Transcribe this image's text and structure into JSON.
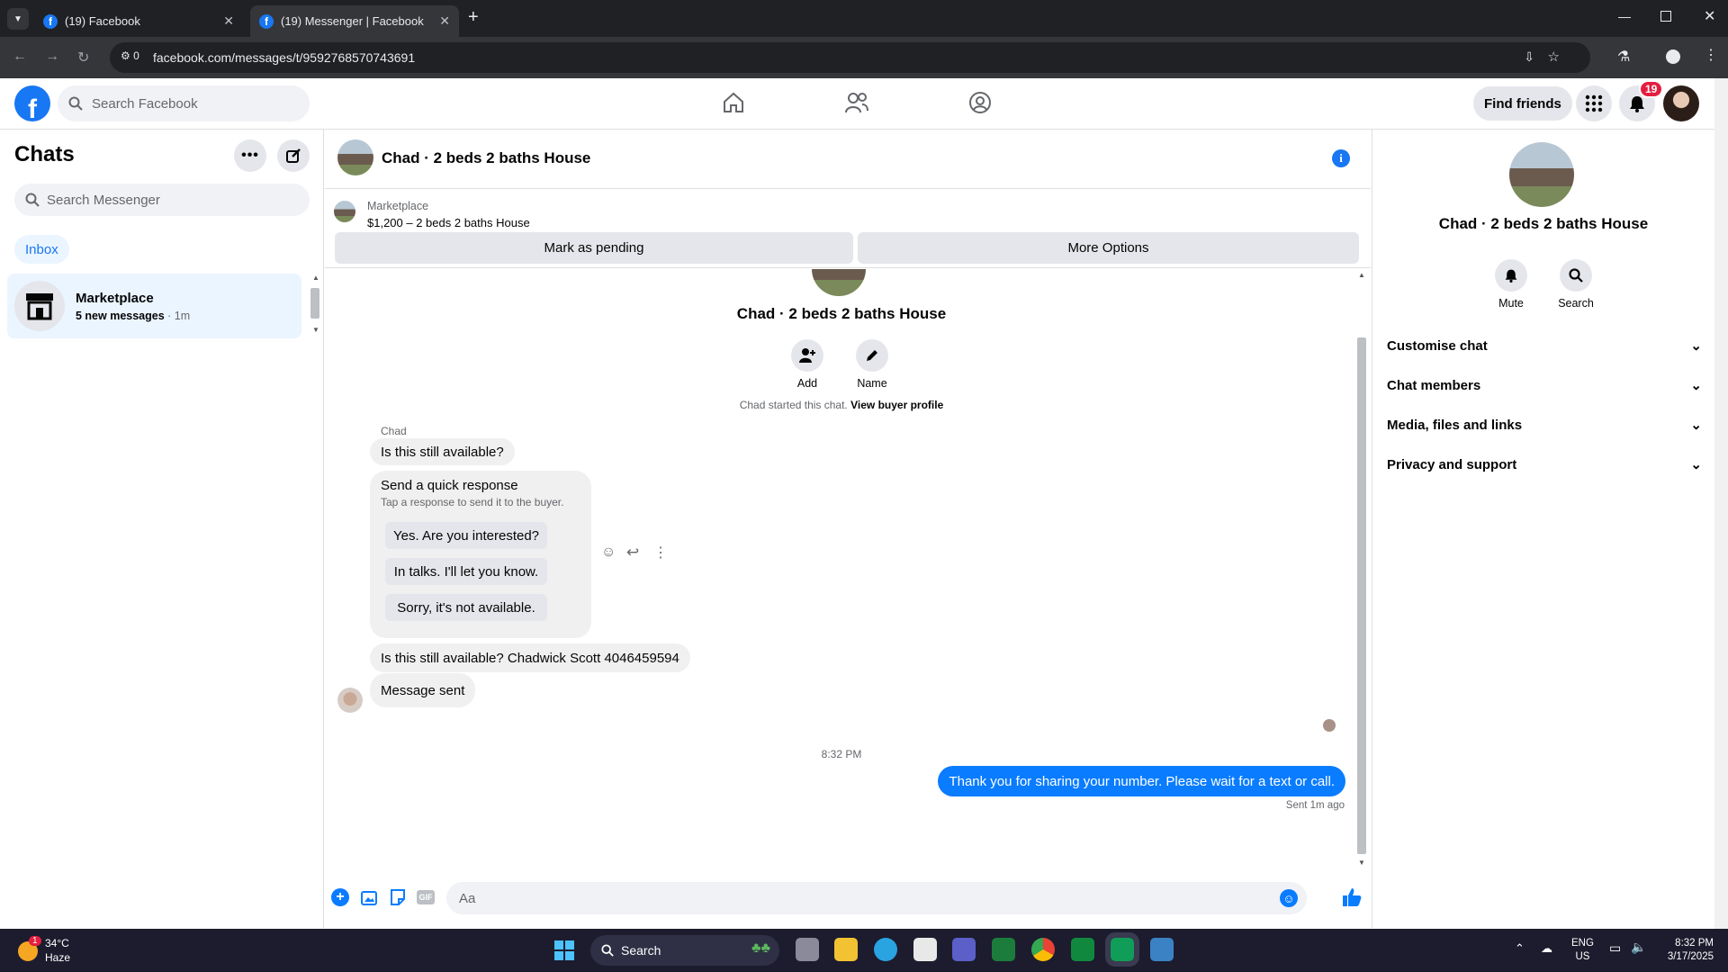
{
  "browser": {
    "tabs": [
      {
        "title": "(19) Facebook"
      },
      {
        "title": "(19) Messenger | Facebook"
      }
    ],
    "url": "facebook.com/messages/t/9592768570743691",
    "site_info_count": "0"
  },
  "fb_header": {
    "search_placeholder": "Search Facebook",
    "find_friends": "Find friends",
    "notification_count": "19"
  },
  "sidebar": {
    "title": "Chats",
    "search_placeholder": "Search Messenger",
    "filter": "Inbox",
    "chats": [
      {
        "name": "Marketplace",
        "preview": "5 new messages",
        "time": "1m"
      }
    ]
  },
  "conversation": {
    "title": "Chad · 2 beds 2 baths House",
    "marketplace_label": "Marketplace",
    "listing": "$1,200 – 2 beds 2 baths House",
    "mark_pending": "Mark as pending",
    "more_options": "More Options",
    "intro_name": "Chad · 2 beds 2 baths House",
    "add_label": "Add",
    "name_label": "Name",
    "started_text": "Chad started this chat.",
    "view_buyer": "View buyer profile",
    "sender": "Chad",
    "msg1": "Is this still available?",
    "quick_title": "Send a quick response",
    "quick_sub": "Tap a response to send it to the buyer.",
    "quick_replies": [
      "Yes. Are you interested?",
      "In talks. I'll let you know.",
      "Sorry, it's not available."
    ],
    "msg2": "Is this still available? Chadwick Scott 4046459594",
    "msg3": "Message sent",
    "timestamp": "8:32 PM",
    "my_msg": "Thank you for sharing your number. Please wait for a text or call.",
    "sent_status": "Sent 1m ago",
    "composer_placeholder": "Aa"
  },
  "right_panel": {
    "title": "Chad · 2 beds 2 baths House",
    "mute": "Mute",
    "search": "Search",
    "sections": [
      "Customise chat",
      "Chat members",
      "Media, files and links",
      "Privacy and support"
    ]
  },
  "taskbar": {
    "temp": "34°C",
    "weather": "Haze",
    "weather_badge": "1",
    "search": "Search",
    "lang1": "ENG",
    "lang2": "US",
    "time": "8:32 PM",
    "date": "3/17/2025"
  },
  "colors": {
    "accent": "#1877f2",
    "chrome": "#202124",
    "bubble_grey": "#f0f0f0"
  }
}
